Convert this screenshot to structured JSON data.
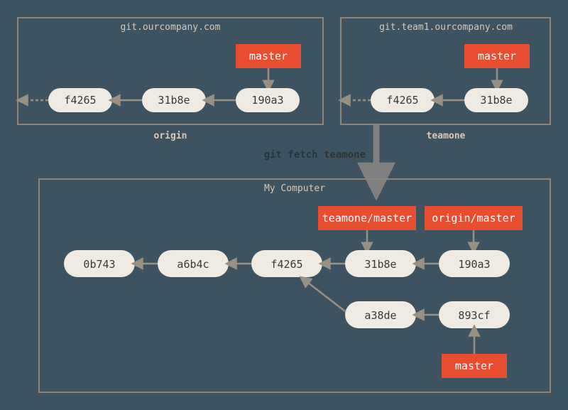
{
  "colors": {
    "bg": "#3d5361",
    "panel_stroke": "#8f8477",
    "commit_fill": "#efeae2",
    "branch_fill": "#e84d2f",
    "arrow": "#999084"
  },
  "command": "git fetch teamone",
  "panels": {
    "origin": {
      "title": "git.ourcompany.com",
      "label": "origin",
      "branch": "master",
      "commits": [
        "f4265",
        "31b8e",
        "190a3"
      ]
    },
    "teamone": {
      "title": "git.team1.ourcompany.com",
      "label": "teamone",
      "branch": "master",
      "commits": [
        "f4265",
        "31b8e"
      ]
    },
    "local": {
      "title": "My Computer",
      "row1": [
        "0b743",
        "a6b4c",
        "f4265",
        "31b8e",
        "190a3"
      ],
      "row2": [
        "a38de",
        "893cf"
      ],
      "branches": {
        "teamone_master": "teamone/master",
        "origin_master": "origin/master",
        "master": "master"
      }
    }
  }
}
